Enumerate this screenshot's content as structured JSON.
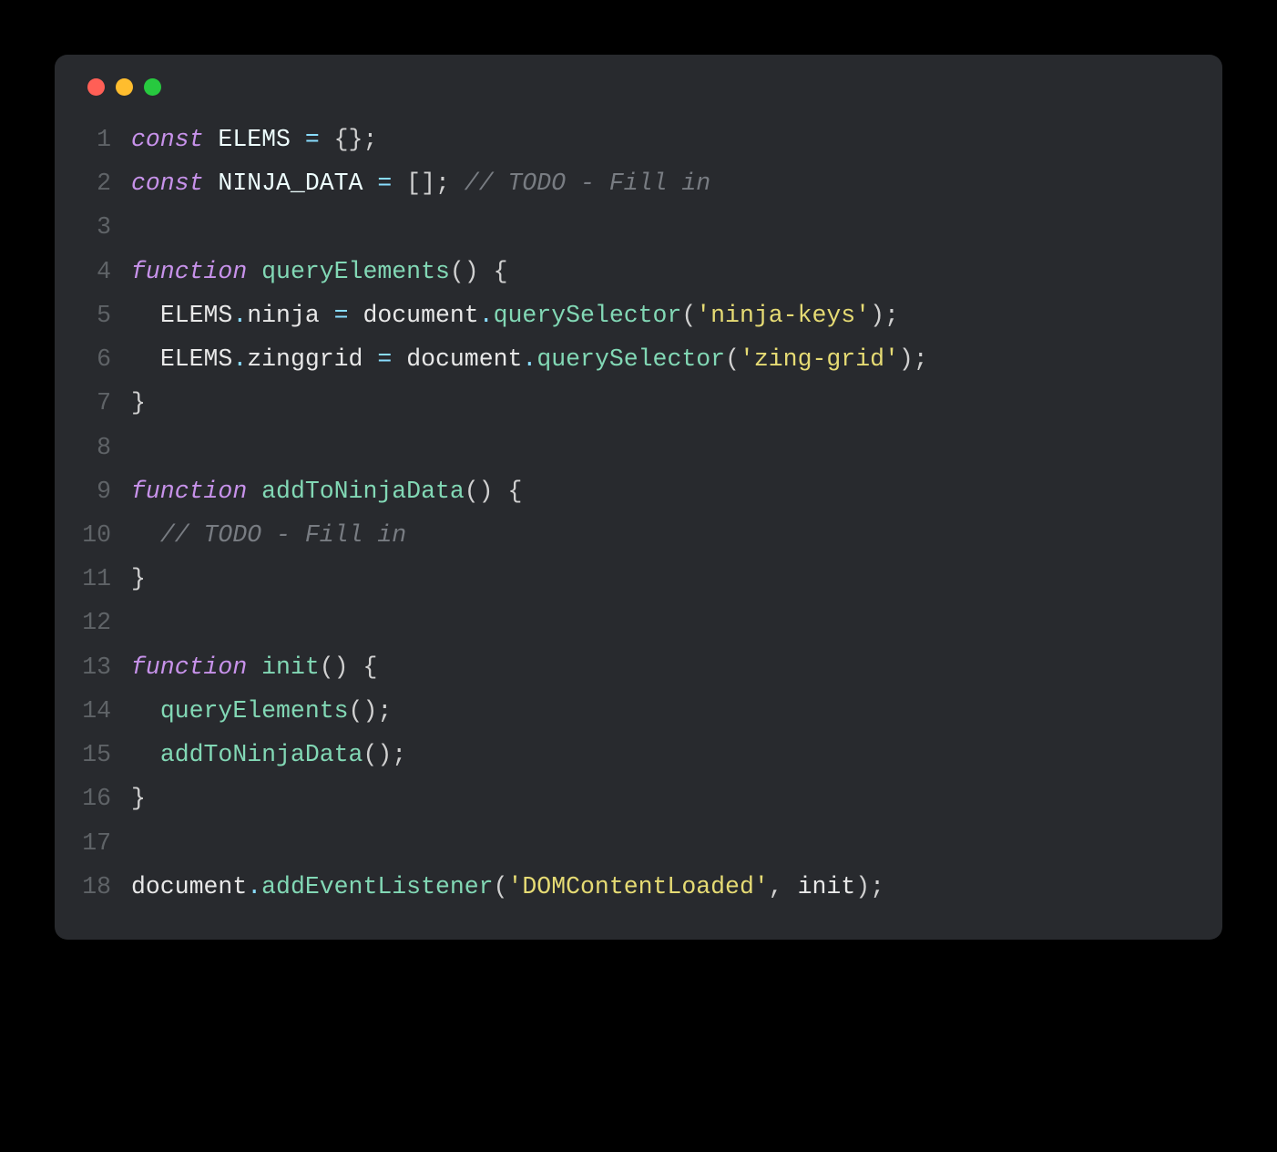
{
  "window": {
    "traffic_lights": {
      "red": "#ff5f56",
      "yellow": "#ffbd2e",
      "green": "#27c93f"
    }
  },
  "code": {
    "lines": [
      {
        "n": "1",
        "tokens": [
          {
            "c": "kw",
            "t": "const"
          },
          {
            "c": "plain",
            "t": " "
          },
          {
            "c": "const-name",
            "t": "ELEMS"
          },
          {
            "c": "plain",
            "t": " "
          },
          {
            "c": "op",
            "t": "="
          },
          {
            "c": "plain",
            "t": " "
          },
          {
            "c": "brace",
            "t": "{};"
          }
        ]
      },
      {
        "n": "2",
        "tokens": [
          {
            "c": "kw",
            "t": "const"
          },
          {
            "c": "plain",
            "t": " "
          },
          {
            "c": "const-name",
            "t": "NINJA_DATA"
          },
          {
            "c": "plain",
            "t": " "
          },
          {
            "c": "op",
            "t": "="
          },
          {
            "c": "plain",
            "t": " "
          },
          {
            "c": "brace",
            "t": "[];"
          },
          {
            "c": "plain",
            "t": " "
          },
          {
            "c": "comment",
            "t": "// TODO - Fill in"
          }
        ]
      },
      {
        "n": "3",
        "tokens": []
      },
      {
        "n": "4",
        "tokens": [
          {
            "c": "fn-kw",
            "t": "function"
          },
          {
            "c": "plain",
            "t": " "
          },
          {
            "c": "fn-name",
            "t": "queryElements"
          },
          {
            "c": "brace",
            "t": "() {"
          }
        ]
      },
      {
        "n": "5",
        "tokens": [
          {
            "c": "plain",
            "t": "  "
          },
          {
            "c": "obj",
            "t": "ELEMS"
          },
          {
            "c": "dot-sep",
            "t": "."
          },
          {
            "c": "prop",
            "t": "ninja"
          },
          {
            "c": "plain",
            "t": " "
          },
          {
            "c": "op",
            "t": "="
          },
          {
            "c": "plain",
            "t": " "
          },
          {
            "c": "obj",
            "t": "document"
          },
          {
            "c": "dot-sep",
            "t": "."
          },
          {
            "c": "method",
            "t": "querySelector"
          },
          {
            "c": "brace",
            "t": "("
          },
          {
            "c": "str",
            "t": "'ninja-keys'"
          },
          {
            "c": "brace",
            "t": ");"
          }
        ]
      },
      {
        "n": "6",
        "tokens": [
          {
            "c": "plain",
            "t": "  "
          },
          {
            "c": "obj",
            "t": "ELEMS"
          },
          {
            "c": "dot-sep",
            "t": "."
          },
          {
            "c": "prop",
            "t": "zinggrid"
          },
          {
            "c": "plain",
            "t": " "
          },
          {
            "c": "op",
            "t": "="
          },
          {
            "c": "plain",
            "t": " "
          },
          {
            "c": "obj",
            "t": "document"
          },
          {
            "c": "dot-sep",
            "t": "."
          },
          {
            "c": "method",
            "t": "querySelector"
          },
          {
            "c": "brace",
            "t": "("
          },
          {
            "c": "str",
            "t": "'zing-grid'"
          },
          {
            "c": "brace",
            "t": ");"
          }
        ]
      },
      {
        "n": "7",
        "tokens": [
          {
            "c": "brace",
            "t": "}"
          }
        ]
      },
      {
        "n": "8",
        "tokens": []
      },
      {
        "n": "9",
        "tokens": [
          {
            "c": "fn-kw",
            "t": "function"
          },
          {
            "c": "plain",
            "t": " "
          },
          {
            "c": "fn-name",
            "t": "addToNinjaData"
          },
          {
            "c": "brace",
            "t": "() {"
          }
        ]
      },
      {
        "n": "10",
        "tokens": [
          {
            "c": "plain",
            "t": "  "
          },
          {
            "c": "comment",
            "t": "// TODO - Fill in"
          }
        ]
      },
      {
        "n": "11",
        "tokens": [
          {
            "c": "brace",
            "t": "}"
          }
        ]
      },
      {
        "n": "12",
        "tokens": []
      },
      {
        "n": "13",
        "tokens": [
          {
            "c": "fn-kw",
            "t": "function"
          },
          {
            "c": "plain",
            "t": " "
          },
          {
            "c": "fn-name",
            "t": "init"
          },
          {
            "c": "brace",
            "t": "() {"
          }
        ]
      },
      {
        "n": "14",
        "tokens": [
          {
            "c": "plain",
            "t": "  "
          },
          {
            "c": "method",
            "t": "queryElements"
          },
          {
            "c": "brace",
            "t": "();"
          }
        ]
      },
      {
        "n": "15",
        "tokens": [
          {
            "c": "plain",
            "t": "  "
          },
          {
            "c": "method",
            "t": "addToNinjaData"
          },
          {
            "c": "brace",
            "t": "();"
          }
        ]
      },
      {
        "n": "16",
        "tokens": [
          {
            "c": "brace",
            "t": "}"
          }
        ]
      },
      {
        "n": "17",
        "tokens": []
      },
      {
        "n": "18",
        "tokens": [
          {
            "c": "obj",
            "t": "document"
          },
          {
            "c": "dot-sep",
            "t": "."
          },
          {
            "c": "method",
            "t": "addEventListener"
          },
          {
            "c": "brace",
            "t": "("
          },
          {
            "c": "str",
            "t": "'DOMContentLoaded'"
          },
          {
            "c": "brace",
            "t": ", "
          },
          {
            "c": "plain",
            "t": "init"
          },
          {
            "c": "brace",
            "t": ");"
          }
        ]
      }
    ]
  }
}
